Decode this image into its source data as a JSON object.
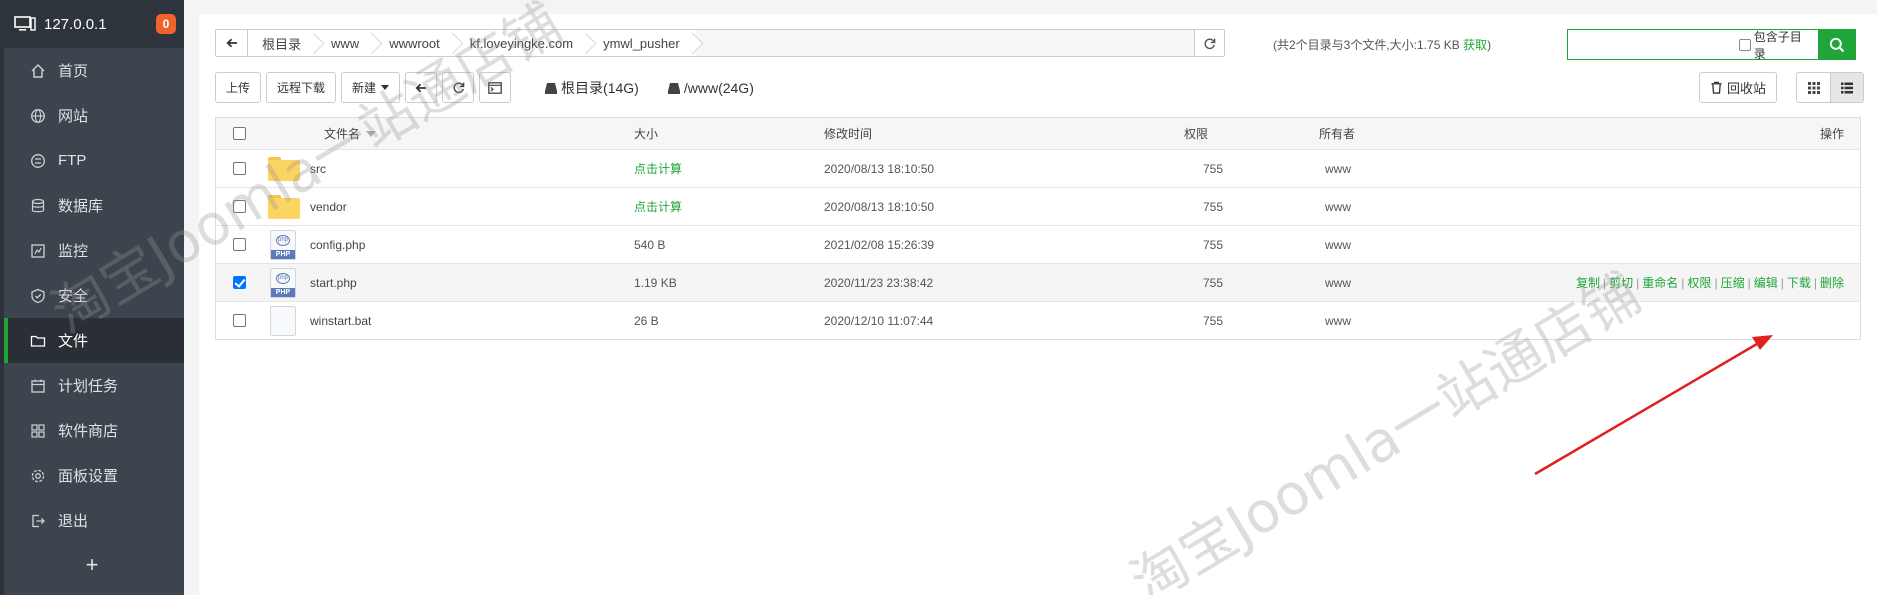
{
  "sidebar": {
    "host": "127.0.0.1",
    "badge": "0",
    "items": [
      {
        "label": "首页",
        "icon": "home-icon"
      },
      {
        "label": "网站",
        "icon": "globe-icon"
      },
      {
        "label": "FTP",
        "icon": "ftp-icon"
      },
      {
        "label": "数据库",
        "icon": "database-icon"
      },
      {
        "label": "监控",
        "icon": "monitor-icon"
      },
      {
        "label": "安全",
        "icon": "shield-icon"
      },
      {
        "label": "文件",
        "icon": "folder-icon",
        "active": true
      },
      {
        "label": "计划任务",
        "icon": "calendar-icon"
      },
      {
        "label": "软件商店",
        "icon": "apps-icon"
      },
      {
        "label": "面板设置",
        "icon": "gear-icon"
      },
      {
        "label": "退出",
        "icon": "logout-icon"
      }
    ],
    "add_label": "+"
  },
  "path": {
    "crumbs": [
      "根目录",
      "www",
      "wwwroot",
      "kf.loveyingke.com",
      "ymwl_pusher"
    ],
    "summary": "(共2个目录与3个文件,大小:1.75 KB ",
    "fetch": "获取",
    "summary_end": ")"
  },
  "search": {
    "placeholder": "",
    "sub_label": "包含子目录"
  },
  "toolbar": {
    "upload": "上传",
    "remote": "远程下载",
    "new": "新建",
    "disk_root": "根目录(14G)",
    "disk_www": "/www(24G)",
    "recycle": "回收站"
  },
  "table": {
    "headers": {
      "name": "文件名",
      "size": "大小",
      "time": "修改时间",
      "perm": "权限",
      "owner": "所有者",
      "ops": "操作"
    },
    "rows": [
      {
        "name": "src",
        "size": "点击计算",
        "time": "2020/08/13 18:10:50",
        "perm": "755",
        "owner": "www",
        "type": "folder"
      },
      {
        "name": "vendor",
        "size": "点击计算",
        "time": "2020/08/13 18:10:50",
        "perm": "755",
        "owner": "www",
        "type": "folder"
      },
      {
        "name": "config.php",
        "size": "540 B",
        "time": "2021/02/08 15:26:39",
        "perm": "755",
        "owner": "www",
        "type": "php"
      },
      {
        "name": "start.php",
        "size": "1.19 KB",
        "time": "2020/11/23 23:38:42",
        "perm": "755",
        "owner": "www",
        "type": "php",
        "selected": true
      },
      {
        "name": "winstart.bat",
        "size": "26 B",
        "time": "2020/12/10 11:07:44",
        "perm": "755",
        "owner": "www",
        "type": "file"
      }
    ],
    "ops": [
      "复制",
      "剪切",
      "重命名",
      "权限",
      "压缩",
      "编辑",
      "下载",
      "删除"
    ],
    "php_tag": "PHP",
    "php_circle": "php"
  },
  "watermarks": [
    "淘宝Joomla一站通店铺",
    "淘宝Joomla一站通店铺"
  ],
  "colors": {
    "accent": "#20a53a",
    "sidebar": "#3c444d",
    "badge": "#f0632a",
    "arrow": "#e02020"
  }
}
